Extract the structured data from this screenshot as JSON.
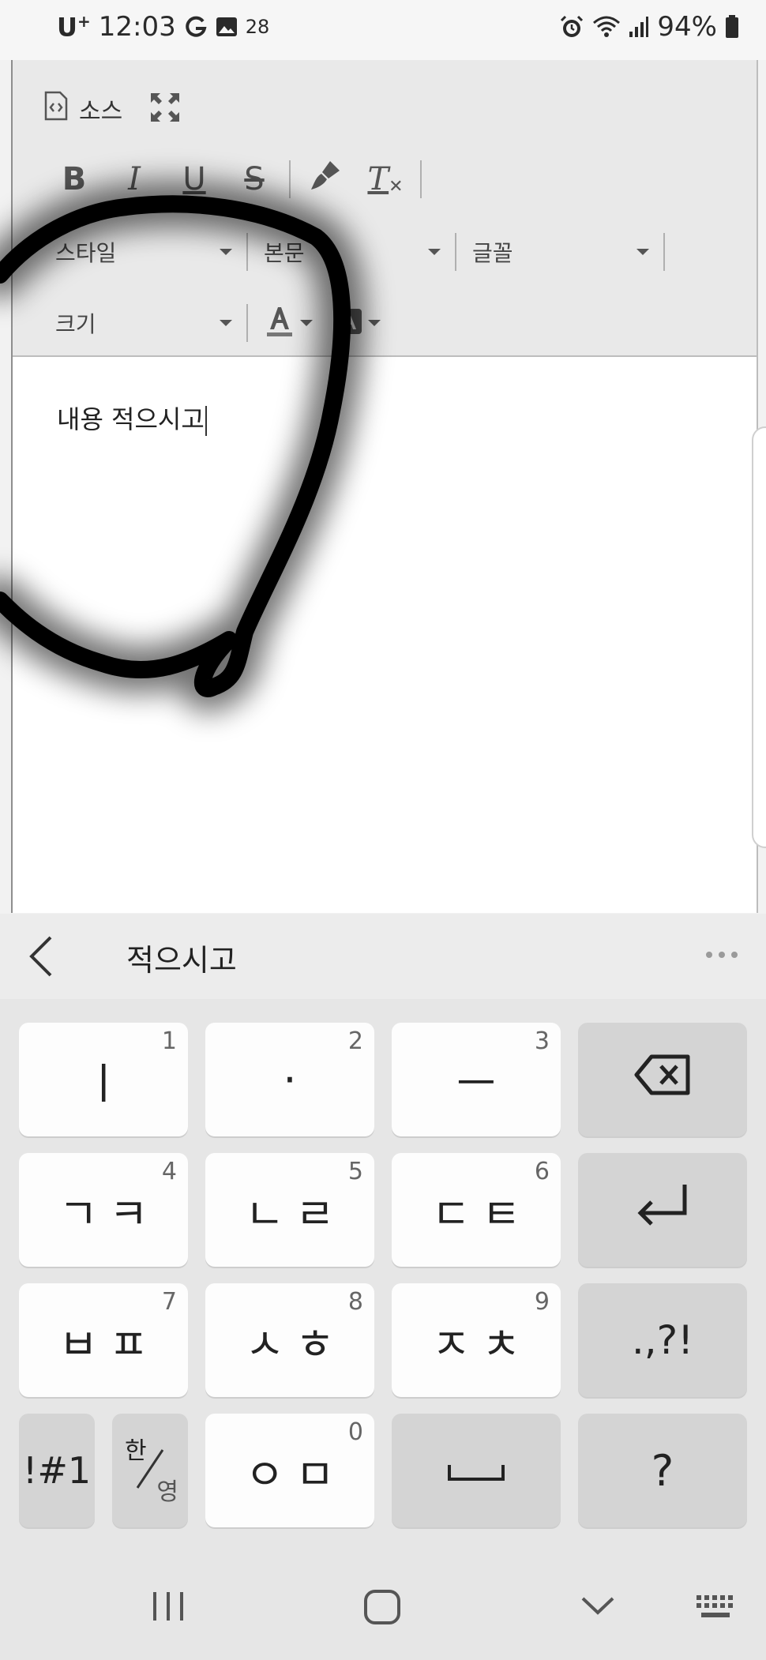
{
  "status_bar": {
    "carrier": "U",
    "carrier_plus": "+",
    "time": "12:03",
    "notification_count": "28",
    "battery": "94%",
    "icons": [
      "google-g-icon",
      "gallery-icon",
      "alarm-icon",
      "wifi-icon",
      "signal-icon",
      "battery-icon"
    ]
  },
  "editor": {
    "toolbar": {
      "source_label": "소스",
      "style_placeholder": "스타일",
      "paragraph_format": "본문",
      "font_label": "글꼴",
      "size_label": "크기",
      "format_buttons": [
        "B",
        "I",
        "U",
        "S"
      ],
      "remove_format_label": "T"
    },
    "content_text": "내용 적으시고"
  },
  "suggestion_bar": {
    "word": "적으시고"
  },
  "keyboard": {
    "row1": [
      {
        "glyph": "ㅣ",
        "num": "1"
      },
      {
        "glyph": "·",
        "num": "2"
      },
      {
        "glyph": "ㅡ",
        "num": "3"
      }
    ],
    "row2": [
      {
        "glyph": "ㄱㅋ",
        "num": "4"
      },
      {
        "glyph": "ㄴㄹ",
        "num": "5"
      },
      {
        "glyph": "ㄷㅌ",
        "num": "6"
      }
    ],
    "row3": [
      {
        "glyph": "ㅂㅍ",
        "num": "7"
      },
      {
        "glyph": "ㅅㅎ",
        "num": "8"
      },
      {
        "glyph": "ㅈㅊ",
        "num": "9"
      }
    ],
    "punct_label": ".,?!",
    "symbols_label": "!#1",
    "lang_top": "한",
    "lang_bottom": "영",
    "row4_glyph": "ㅇㅁ",
    "row4_num": "0",
    "question_label": "?"
  },
  "accent_colors": {
    "toolbar_bg": "#e9e9e9",
    "key_bg": "#fdfdfd",
    "fn_key_bg": "#d4d4d4",
    "scribble": "#000000"
  }
}
